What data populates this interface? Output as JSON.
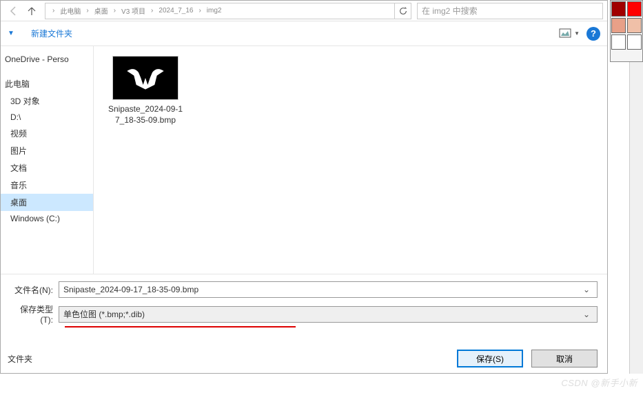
{
  "breadcrumb": {
    "items": [
      "此电脑",
      "桌面",
      "V3 项目",
      "2024_7_16",
      "img2"
    ],
    "sep": "›"
  },
  "search": {
    "placeholder": "在 img2 中搜索"
  },
  "toolbar": {
    "new_folder": "新建文件夹"
  },
  "sidebar": {
    "onedrive": "OneDrive - Perso",
    "this_pc": "此电脑",
    "threed": "3D 对象",
    "d_drive": "D:\\",
    "videos": "视频",
    "pictures": "图片",
    "documents": "文档",
    "music": "音乐",
    "desktop": "桌面",
    "windows_c": "Windows (C:)"
  },
  "files": [
    {
      "name": "Snipaste_2024-09-17_18-35-09.bmp"
    }
  ],
  "fields": {
    "filename_label": "文件名(N):",
    "filename_value": "Snipaste_2024-09-17_18-35-09.bmp",
    "filetype_label": "保存类型(T):",
    "filetype_value": "单色位图 (*.bmp;*.dib)"
  },
  "footer": {
    "hide_folders": "文件夹",
    "save": "保存(S)",
    "cancel": "取消"
  },
  "palette": {
    "colors": [
      "#a00000",
      "#ff0000",
      "#e8a088",
      "#f0c0a8"
    ]
  },
  "watermark": "CSDN @新手小新"
}
